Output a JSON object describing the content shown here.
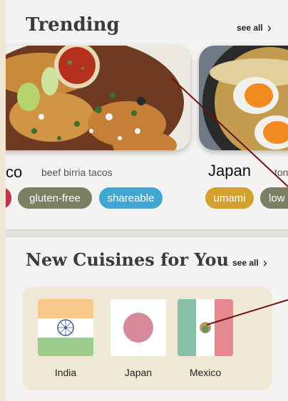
{
  "trending": {
    "title": "Trending",
    "see_all": "see all",
    "cards": [
      {
        "title": "co",
        "description": "beef birria tacos",
        "tags": [
          {
            "label": "",
            "color": "#c0334d"
          },
          {
            "label": "gluten-free",
            "color": "#7d7f65"
          },
          {
            "label": "shareable",
            "color": "#3fa7d1"
          }
        ]
      },
      {
        "title": "Japan",
        "description": "ton",
        "tags": [
          {
            "label": "umami",
            "color": "#d3a12e"
          },
          {
            "label": "low c",
            "color": "#7d7f65"
          }
        ]
      }
    ]
  },
  "cuisines": {
    "title": "New Cuisines for You",
    "see_all": "see all",
    "items": [
      {
        "label": "India"
      },
      {
        "label": "Japan"
      },
      {
        "label": "Mexico"
      }
    ]
  },
  "colors": {
    "background": "#f4f3f1",
    "cuisine_box": "#efe8d4",
    "india_saffron": "#f6c98a",
    "india_green": "#9ccc8c",
    "india_chakra": "#3d5a94",
    "japan_circle": "#d48a9a",
    "mexico_green": "#88bfa7",
    "mexico_red": "#e58890"
  }
}
